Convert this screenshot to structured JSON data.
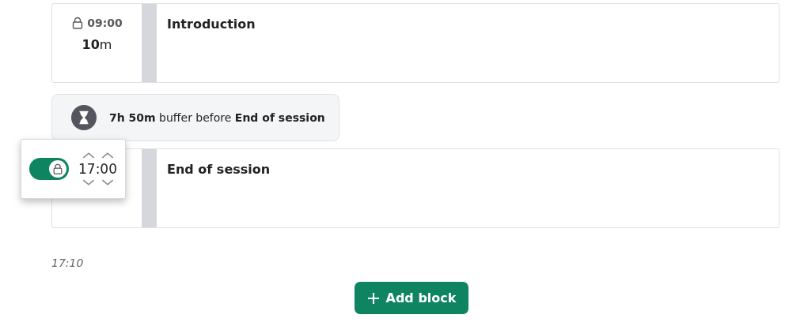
{
  "blocks": [
    {
      "title": "Introduction",
      "locked": true,
      "start": "09:00",
      "duration": "**10**m"
    },
    {
      "title": "End of session"
    }
  ],
  "buffer": {
    "text": "**7h 50m** buffer before **End of session**"
  },
  "time_popover": {
    "locked": true,
    "time": "17:00"
  },
  "end_time": "17:10",
  "add_button": {
    "label": "Add block"
  }
}
